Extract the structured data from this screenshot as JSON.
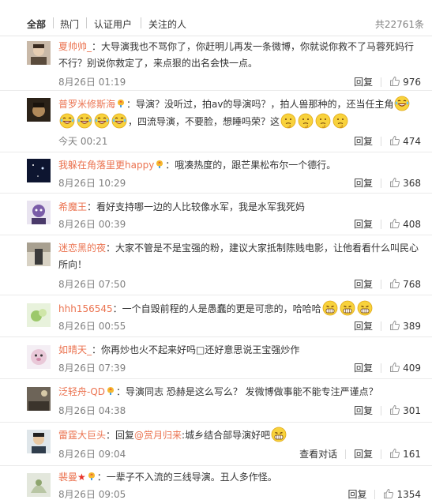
{
  "tabs": [
    {
      "label": "全部"
    },
    {
      "label": "热门"
    },
    {
      "label": "认证用户"
    },
    {
      "label": "关注的人"
    }
  ],
  "total_count": "共22761条",
  "actions": {
    "reply": "回复",
    "view_dialog": "查看对话"
  },
  "comments": [
    {
      "name": "夏帅帅_",
      "text1": "：大导演我也不骂你了，你赶明儿再发一条微博，你就说你救不了马蓉死妈行不行？别说你救定了，来点狠的出名会快一点。",
      "time": "8月26日 01:19",
      "likes": "976"
    },
    {
      "name": "普罗米修斯海",
      "text1": "：导演？没听过，拍av的导演吗？，拍人兽那种的，还当任主角",
      "text2": "，四流导演，不要脸，想睡吗荣？这",
      "time": "今天 00:21",
      "likes": "474"
    },
    {
      "name": "我躲在角落里更happy",
      "text1": "：哦凑热度的，跟芒果松布尔一个德行。",
      "time": "8月26日 10:29",
      "likes": "368"
    },
    {
      "name": "希魔王",
      "text1": "：看好支持哪一边的人比较像水军，我是水军我死妈",
      "time": "8月26日 00:39",
      "likes": "408"
    },
    {
      "name": "迷恋黑的夜",
      "text1": "：大家不管是不是宝强的粉，建议大家抵制陈贱电影，让他看看什么叫民心所向！",
      "time": "8月26日 07:50",
      "likes": "768"
    },
    {
      "name": "hhh156545",
      "text1": "：一个自毁前程的人是愚蠢的更是可悲的，哈哈哈",
      "time": "8月26日 00:55",
      "likes": "389"
    },
    {
      "name": "如晴天_",
      "text1": "：你再炒也火不起来好吗□还好意思说王宝强炒作",
      "time": "8月26日 07:39",
      "likes": "409"
    },
    {
      "name": "泛轻舟-QD",
      "text1": "：导演同志 恐赫是这么写么？ 发微博做事能不能专注严谨点？",
      "time": "8月26日 04:38",
      "likes": "301"
    },
    {
      "name": "雷霆大巨头",
      "text1": "：回复",
      "mention": "@赏月归来",
      "text2": ":城乡结合部导演好吧",
      "time": "8月26日 09:04",
      "likes": "161"
    },
    {
      "name": "裴曼",
      "text1": "：一辈子不入流的三线导演。丑人多作怪。",
      "time": "8月26日 09:05",
      "likes": "1354"
    }
  ]
}
